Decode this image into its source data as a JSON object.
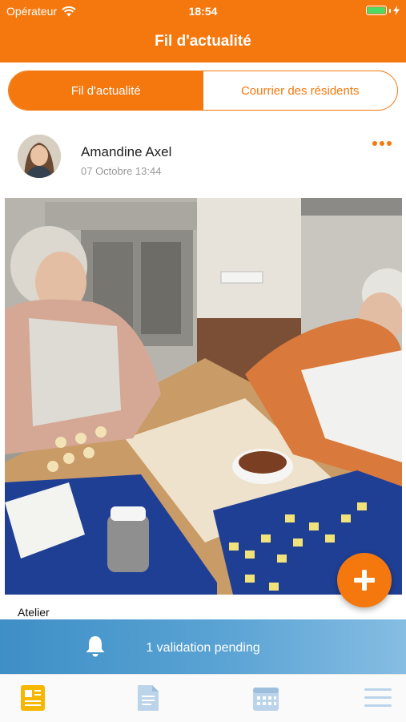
{
  "status_bar": {
    "carrier": "Opérateur",
    "time": "18:54"
  },
  "nav": {
    "title": "Fil d'actualité"
  },
  "segments": {
    "active": "Fil d'actualité",
    "inactive": "Courrier des résidents"
  },
  "post": {
    "author": "Amandine Axel",
    "date": "07 Octobre 13:44",
    "caption": "Atelier"
  },
  "banner": {
    "text": "1 validation pending"
  },
  "colors": {
    "accent": "#f5780f",
    "banner_blue": "#4a98cc",
    "tab_active": "#f5b700",
    "tab_inactive": "#bcd4ea"
  },
  "icons": {
    "status": [
      "wifi-icon",
      "battery-icon",
      "charging-icon"
    ],
    "tabs": [
      "newsfeed-icon",
      "document-icon",
      "calendar-icon",
      "menu-icon"
    ],
    "banner": "bell-icon",
    "fab": "plus-icon",
    "post": "more-icon"
  }
}
